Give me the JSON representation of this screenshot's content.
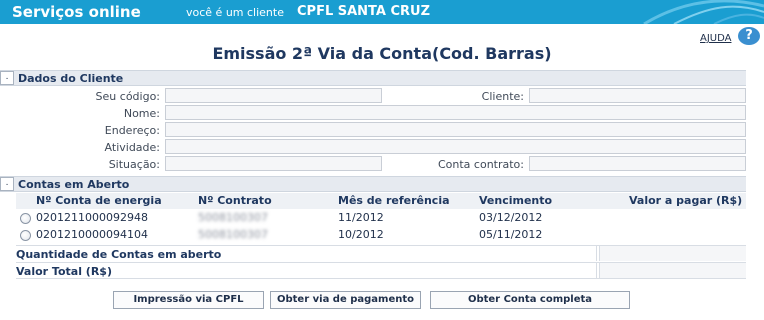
{
  "header": {
    "app_title": "Serviços online",
    "client_prefix": "você é um cliente",
    "client_name": "CPFL SANTA CRUZ",
    "brand_color": "#1a9ed1"
  },
  "help": {
    "label": "AJUDA",
    "icon": "question-icon"
  },
  "page_title": "Emissão 2ª Via da Conta(Cod. Barras)",
  "client_section": {
    "title": "Dados do Cliente",
    "marker": ".",
    "fields": {
      "codigo_label": "Seu código:",
      "cliente_label": "Cliente:",
      "nome_label": "Nome:",
      "endereco_label": "Endereço:",
      "atividade_label": "Atividade:",
      "situacao_label": "Situação:",
      "conta_contrato_label": "Conta contrato:"
    }
  },
  "accounts_section": {
    "title": "Contas em Aberto",
    "marker": ".",
    "columns": [
      "Nº Conta de energia",
      "Nº Contrato",
      "Mês de referência",
      "Vencimento",
      "Valor a pagar (R$)"
    ],
    "rows": [
      {
        "conta": "0201211000092948",
        "contrato": "5008100307",
        "mes": "11/2012",
        "vencimento": "03/12/2012",
        "valor": ""
      },
      {
        "conta": "0201210000094104",
        "contrato": "5008100307",
        "mes": "10/2012",
        "vencimento": "05/11/2012",
        "valor": ""
      }
    ],
    "quantidade_label": "Quantidade de Contas em aberto",
    "valor_total_label": "Valor Total (R$)"
  },
  "buttons": {
    "impressao": "Impressão via CPFL",
    "obter_via": "Obter via de pagamento",
    "obter_conta": "Obter Conta completa"
  }
}
